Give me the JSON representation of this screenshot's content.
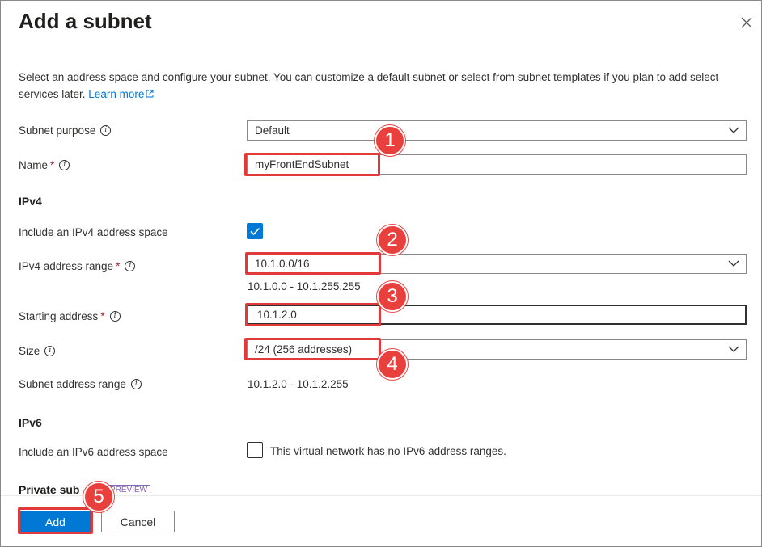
{
  "dialog": {
    "title": "Add a subnet",
    "description": "Select an address space and configure your subnet. You can customize a default subnet or select from subnet templates if you plan to add select services later.",
    "learn_more": "Learn more"
  },
  "fields": {
    "subnet_purpose": {
      "label": "Subnet purpose",
      "value": "Default"
    },
    "name": {
      "label": "Name",
      "required": "*",
      "value": "myFrontEndSubnet"
    },
    "ipv4_section": "IPv4",
    "include_ipv4": {
      "label": "Include an IPv4 address space",
      "checked": true
    },
    "ipv4_range": {
      "label": "IPv4 address range",
      "required": "*",
      "value": "10.1.0.0/16",
      "hint": "10.1.0.0 - 10.1.255.255"
    },
    "starting_address": {
      "label": "Starting address",
      "required": "*",
      "value": "10.1.2.0"
    },
    "size": {
      "label": "Size",
      "value": "/24 (256 addresses)"
    },
    "subnet_address_range": {
      "label": "Subnet address range",
      "value": "10.1.2.0 - 10.1.2.255"
    },
    "ipv6_section": "IPv6",
    "include_ipv6": {
      "label": "Include an IPv6 address space",
      "checked": false,
      "note": "This virtual network has no IPv6 address ranges."
    },
    "private_section_partial": "Private sub",
    "preview_tag": "PREVIEW"
  },
  "footer": {
    "add_label": "Add",
    "cancel_label": "Cancel"
  },
  "annotations": [
    "1",
    "2",
    "3",
    "4",
    "5"
  ],
  "colors": {
    "accent": "#0078d4",
    "highlight": "#e03a3a",
    "badge": "#e9403d"
  }
}
